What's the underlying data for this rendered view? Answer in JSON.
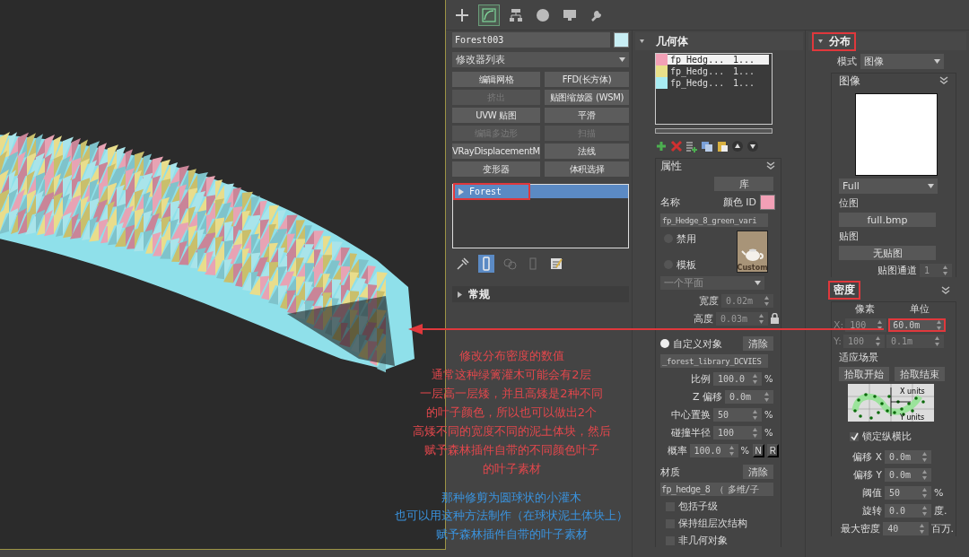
{
  "toolbar": [
    {
      "kind": "create",
      "selected": false
    },
    {
      "kind": "modify",
      "selected": true
    },
    {
      "kind": "hierarchy",
      "selected": false
    },
    {
      "kind": "motion",
      "selected": false
    },
    {
      "kind": "display",
      "selected": false
    },
    {
      "kind": "utilities",
      "selected": false
    }
  ],
  "object": {
    "name": "Forest003",
    "color": "#c8eef4"
  },
  "modifier_list": {
    "label": "修改器列表"
  },
  "modifier_buttons": [
    {
      "label": "编辑网格",
      "disabled": false
    },
    {
      "label": "FFD(长方体)",
      "disabled": false
    },
    {
      "label": "挤出",
      "disabled": true
    },
    {
      "label": "贴图缩放器 (WSM)",
      "disabled": false
    },
    {
      "label": "UVW 贴图",
      "disabled": false
    },
    {
      "label": "平滑",
      "disabled": false
    },
    {
      "label": "编辑多边形",
      "disabled": true
    },
    {
      "label": "扫描",
      "disabled": true
    },
    {
      "label": "VRayDisplacementM",
      "disabled": false
    },
    {
      "label": "法线",
      "disabled": false
    },
    {
      "label": "变形器",
      "disabled": false
    },
    {
      "label": "体积选择",
      "disabled": false
    }
  ],
  "stack": [
    {
      "label": "Forest",
      "selected": true,
      "highlighted": true
    }
  ],
  "stack_tools": [
    {
      "kind": "pin",
      "selected": false,
      "disabled": false
    },
    {
      "kind": "show_end",
      "selected": true,
      "disabled": false
    },
    {
      "kind": "make_unique",
      "selected": false,
      "disabled": true
    },
    {
      "kind": "remove",
      "selected": false,
      "disabled": true
    },
    {
      "kind": "configure",
      "selected": false,
      "disabled": false
    }
  ],
  "general_rollout": {
    "title": "常规",
    "expanded": false
  },
  "geometry": {
    "title": "几何体",
    "expanded": true,
    "items": [
      {
        "name": "fp_Hedg...",
        "count": "1...",
        "color": "#f2a0b6",
        "selected": true
      },
      {
        "name": "fp_Hedg...",
        "count": "1...",
        "color": "#e8e08a",
        "selected": false
      },
      {
        "name": "fp_Hedg...",
        "count": "1...",
        "color": "#a8ecf2",
        "selected": false
      }
    ],
    "list_tools": [
      {
        "kind": "add"
      },
      {
        "kind": "delete"
      },
      {
        "kind": "add_list"
      },
      {
        "kind": "copy"
      },
      {
        "kind": "paste"
      },
      {
        "kind": "up"
      },
      {
        "kind": "down"
      }
    ],
    "properties": {
      "title": "属性",
      "library_button": "库",
      "name_label": "名称",
      "color_label": "颜色 ID",
      "color": "#f2a0b6",
      "name_value": "fp_Hedge_8_green_vari",
      "radios": [
        {
          "label": "禁用",
          "selected": false
        },
        {
          "label": "模板",
          "selected": false
        }
      ],
      "thumbnail_caption": "Custom",
      "template_shape": {
        "value": "一个平面",
        "disabled": true
      },
      "size_fields": [
        {
          "label": "宽度",
          "value": "0.02m",
          "disabled": true
        },
        {
          "label": "高度",
          "value": "0.03m",
          "disabled": true
        }
      ],
      "custom_object": {
        "label": "自定义对象",
        "selected": true,
        "clear_button": "清除",
        "value": "_forest_library_DCVIES"
      },
      "fields": [
        {
          "label": "比例",
          "value": "100.0",
          "unit": "%"
        },
        {
          "label": "Z 偏移",
          "value": "0.0m"
        },
        {
          "label": "中心置换",
          "value": "50",
          "unit": "%"
        },
        {
          "label": "碰撞半径",
          "value": "100",
          "unit": "%"
        },
        {
          "label": "概率",
          "value": "100.0",
          "unit": "%",
          "flags": [
            "N",
            "R"
          ]
        }
      ],
      "material": {
        "label": "材质",
        "clear_button": "清除",
        "value": "fp_hedge_8 （ 多维/子"
      },
      "checkboxes": [
        {
          "label": "包括子级",
          "checked": false
        },
        {
          "label": "保持组层次结构",
          "checked": false
        },
        {
          "label": "非几何对象",
          "checked": false
        }
      ]
    }
  },
  "distribution": {
    "title": "分布",
    "highlighted": true,
    "mode_label": "模式",
    "mode": "图像",
    "image": {
      "title": "图像",
      "preset": "Full",
      "bitmap_label": "位图",
      "bitmap": "full.bmp",
      "map_label": "贴图",
      "map": "无贴图",
      "channel_label": "贴图通道",
      "channel": "1"
    },
    "density": {
      "title": "密度",
      "highlighted": true,
      "pixels_label": "像素",
      "units_label": "单位",
      "rows": [
        {
          "axis": "X:",
          "pixels": "100",
          "units": "60.0m",
          "pixels_disabled": true,
          "units_disabled": false,
          "highlighted": true
        },
        {
          "axis": "Y:",
          "pixels": "100",
          "units": "0.1m",
          "pixels_disabled": true,
          "units_disabled": true,
          "highlighted": false
        }
      ],
      "fit_label": "适应场景",
      "pick_buttons": [
        "拾取开始",
        "拾取结束"
      ],
      "diagram_labels": [
        "X units",
        "Y units"
      ],
      "lock": {
        "label": "锁定纵横比",
        "checked": true
      },
      "fields": [
        {
          "label": "偏移 X",
          "value": "0.0m"
        },
        {
          "label": "偏移 Y",
          "value": "0.0m"
        },
        {
          "label": "阈值",
          "value": "50",
          "unit": "%"
        },
        {
          "label": "旋转",
          "value": "0.0",
          "unit": "度."
        },
        {
          "label": "最大密度",
          "value": "40",
          "unit": "百万."
        }
      ]
    }
  },
  "annotations": [
    {
      "text": "修改分布密度的数值",
      "color": "#e3474c"
    },
    {
      "text": "通常这种绿篱灌木可能会有2层",
      "color": "#e3474c"
    },
    {
      "text": "一层高一层矮，并且高矮是2种不同",
      "color": "#e3474c"
    },
    {
      "text": "的叶子颜色，所以也可以做出2个",
      "color": "#e3474c"
    },
    {
      "text": "高矮不同的宽度不同的泥土体块，然后",
      "color": "#e3474c"
    },
    {
      "text": "赋予森林插件自带的不同颜色叶子",
      "color": "#e3474c"
    },
    {
      "text": "的叶子素材",
      "color": "#e3474c"
    },
    {
      "text": "那种修剪为圆球状的小灌木",
      "color": "#3a92dc"
    },
    {
      "text": "也可以用这种方法制作（在球状泥土体块上）",
      "color": "#3a92dc"
    },
    {
      "text": "赋予森林插件自带的叶子素材",
      "color": "#3a92dc"
    }
  ]
}
